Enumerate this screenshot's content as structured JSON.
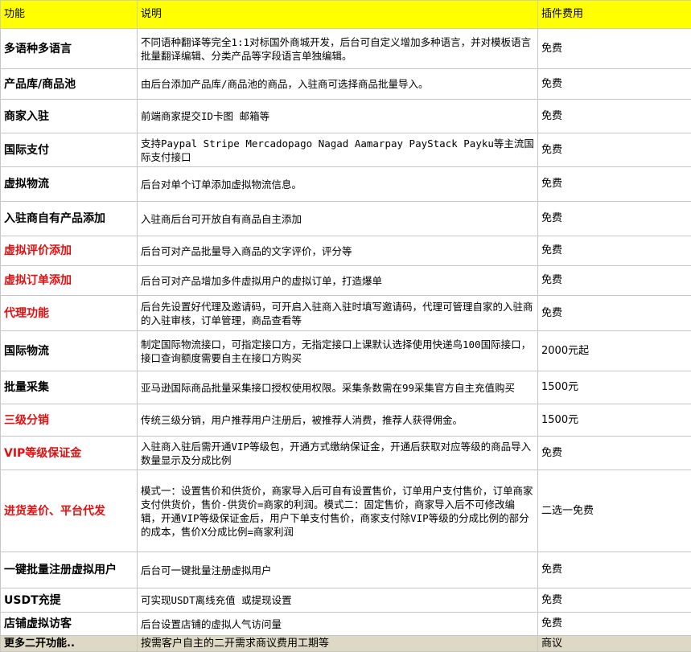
{
  "header": {
    "col1": "功能",
    "col2": "说明",
    "col3": "插件费用"
  },
  "rows": [
    {
      "feature": "多语种多语言",
      "desc": "不同语种翻译等完全1:1对标国外商城开发，后台可自定义增加多种语言，并对模板语言批量翻译编辑、分类产品等字段语言单独编辑。",
      "fee": "免费",
      "red": false
    },
    {
      "feature": "产品库/商品池",
      "desc": "由后台添加产品库/商品池的商品，入驻商可选择商品批量导入。",
      "fee": "免费",
      "red": false
    },
    {
      "feature": "商家入驻",
      "desc": "前端商家提交ID卡图 邮箱等",
      "fee": "免费",
      "red": false
    },
    {
      "feature": "国际支付",
      "desc": "支持Paypal Stripe Mercadopago Nagad Aamarpay PayStack Payku等主流国际支付接口",
      "fee": "免费",
      "red": false
    },
    {
      "feature": "虚拟物流",
      "desc": "后台对单个订单添加虚拟物流信息。",
      "fee": "免费",
      "red": false
    },
    {
      "feature": "入驻商自有产品添加",
      "desc": "入驻商后台可开放自有商品自主添加",
      "fee": "免费",
      "red": false
    },
    {
      "feature": "虚拟评价添加",
      "desc": "后台可对产品批量导入商品的文字评价，评分等",
      "fee": "免费",
      "red": true
    },
    {
      "feature": "虚拟订单添加",
      "desc": "后台可对产品增加多件虚拟用户的虚拟订单，打造爆单",
      "fee": "免费",
      "red": true
    },
    {
      "feature": "代理功能",
      "desc": "后台先设置好代理及邀请码，可开启入驻商入驻时填写邀请码，代理可管理自家的入驻商的入驻审核，订单管理，商品查看等",
      "fee": "免费",
      "red": true
    },
    {
      "feature": "国际物流",
      "desc": "制定国际物流接口，可指定接口方，无指定接口上课默认选择使用快递鸟100国际接口，接口查询额度需要自主在接口方购买",
      "fee": "2000元起",
      "red": false
    },
    {
      "feature": "批量采集",
      "desc": "亚马逊国际商品批量采集接口授权使用权限。采集条数需在99采集官方自主充值购买",
      "fee": "1500元",
      "red": false
    },
    {
      "feature": "三级分销",
      "desc": "传统三级分销，用户推荐用户注册后，被推荐人消费，推荐人获得佣金。",
      "fee": "1500元",
      "red": true
    },
    {
      "feature": "VIP等级保证金",
      "desc": "入驻商入驻后需开通VIP等级包，开通方式缴纳保证金，开通后获取对应等级的商品导入数量显示及分成比例",
      "fee": "免费",
      "red": true
    },
    {
      "feature": "进货差价、平台代发",
      "desc": "模式一：设置售价和供货价，商家导入后可自有设置售价，订单用户支付售价，订单商家支付供货价，售价-供货价=商家的利润。模式二：固定售价，商家导入后不可修改编辑，开通VIP等级保证金后，用户下单支付售价，商家支付除VIP等级的分成比例的部分的成本，售价X分成比例=商家利润",
      "fee": "二选一免费",
      "red": true
    },
    {
      "feature": "一键批量注册虚拟用户",
      "desc": "后台可一键批量注册虚拟用户",
      "fee": "免费",
      "red": false
    },
    {
      "feature": "USDT充提",
      "desc": "可实现USDT离线充值 或提现设置",
      "fee": "免费",
      "red": false
    },
    {
      "feature": "店铺虚拟访客",
      "desc": "后台设置店铺的虚拟人气访问量",
      "fee": "免费",
      "red": false
    }
  ],
  "footer": {
    "feature": "更多二开功能..",
    "desc": "按需客户自主的二开需求商议费用工期等",
    "fee": "商议"
  },
  "colors": {
    "header_bg": "#ffff00",
    "footer_bg": "#ddd9c4",
    "red_text": "#e01010",
    "grid": "#c6c6c6"
  }
}
